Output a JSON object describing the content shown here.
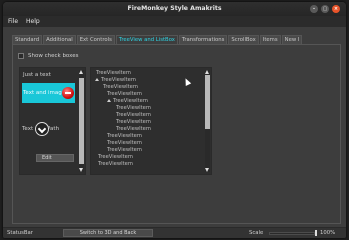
{
  "window": {
    "title": "FireMonkey Style Amakrits",
    "controls": {
      "minimize": "–",
      "maximize": "▢",
      "close": "×"
    }
  },
  "menu": {
    "items": [
      "File",
      "Help"
    ]
  },
  "tabs": [
    {
      "label": "Standard",
      "active": false
    },
    {
      "label": "Additional",
      "active": false
    },
    {
      "label": "Ext Controls",
      "active": false
    },
    {
      "label": "TreeView and ListBox",
      "active": true
    },
    {
      "label": "Transformations",
      "active": false
    },
    {
      "label": "ScrollBox",
      "active": false
    },
    {
      "label": "Items",
      "active": false
    },
    {
      "label": "New I",
      "active": false
    }
  ],
  "options": {
    "show_checkboxes_label": "Show check boxes",
    "show_checkboxes_checked": false
  },
  "listbox": {
    "items": [
      "Just a text",
      "Text and image",
      "Text and Path"
    ],
    "edit_label": "Edit",
    "selected_index": 1
  },
  "treeview": {
    "items": [
      {
        "label": "TreeViewItem",
        "expanded": false
      },
      {
        "label": "TreeViewItem",
        "expanded": true
      },
      {
        "label": "TreeViewItem",
        "expanded": false
      },
      {
        "label": "TreeViewItem",
        "expanded": false
      },
      {
        "label": "TreeViewItem",
        "expanded": true
      },
      {
        "label": "TreeViewItem",
        "expanded": false
      },
      {
        "label": "TreeViewItem",
        "expanded": false
      },
      {
        "label": "TreeViewItem",
        "expanded": false
      },
      {
        "label": "TreeViewItem",
        "expanded": false
      },
      {
        "label": "TreeViewItem",
        "expanded": false
      },
      {
        "label": "TreeViewItem",
        "expanded": false
      },
      {
        "label": "TreeViewItem",
        "expanded": false
      },
      {
        "label": "TreeViewItem",
        "expanded": false
      },
      {
        "label": "TreeViewItem",
        "expanded": false
      }
    ]
  },
  "statusbar": {
    "label": "StatusBar",
    "switch_button": "Switch to 3D and Back",
    "scale_label": "Scale",
    "scale_value": "100%",
    "scale_fraction": 1.0
  },
  "colors": {
    "accent": "#19c7d8",
    "tab_active_text": "#2fd6e6",
    "close_button": "#e9542a"
  }
}
